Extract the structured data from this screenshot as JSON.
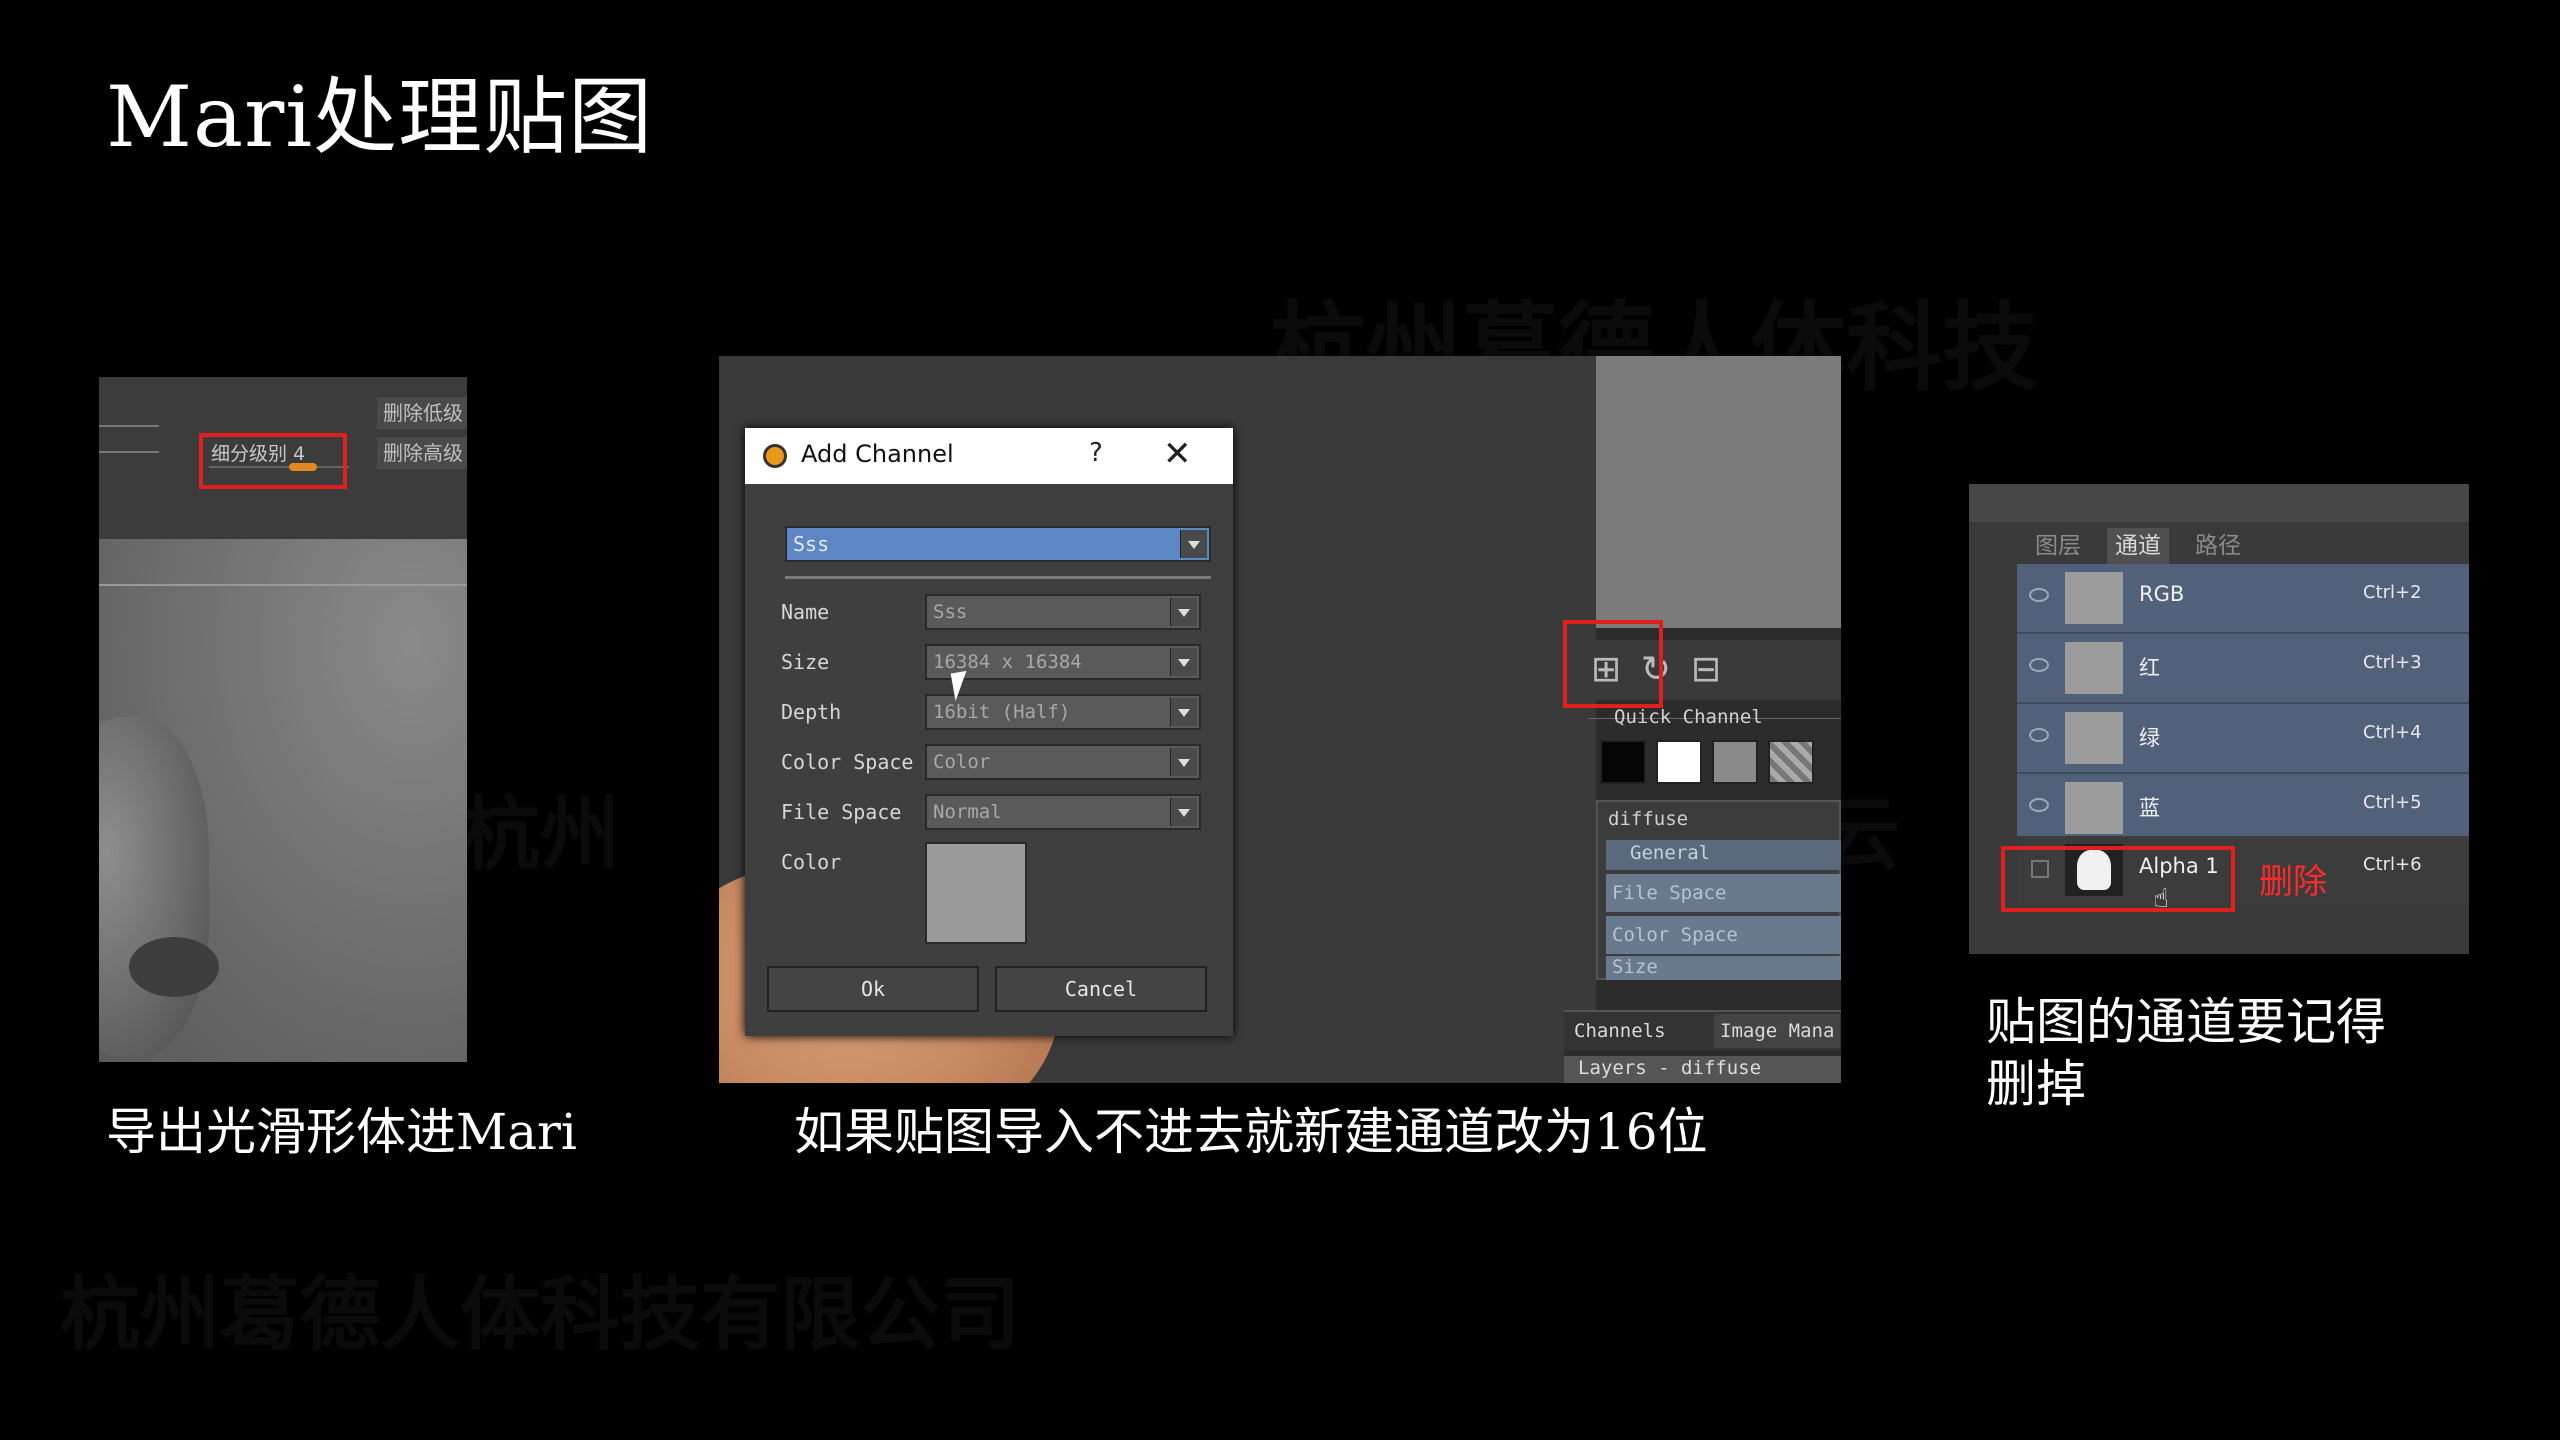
{
  "slide": {
    "title": "Mari处理贴图"
  },
  "watermarks": {
    "top": "杭州葛德人体科技",
    "bottom": "杭州葛德人体科技有限公司",
    "mid_left": "杭州",
    "mid_right": "云"
  },
  "panel_zbrush": {
    "subdivision_label": "细分级别 4",
    "buttons": [
      "删除低级",
      "删除高级"
    ],
    "caption": "导出光滑形体进Mari"
  },
  "panel_mari": {
    "dialog": {
      "title": "Add Channel",
      "help": "?",
      "close": "✕",
      "channel_preset": "Sss",
      "fields": [
        {
          "label": "Name",
          "value": "Sss"
        },
        {
          "label": "Size",
          "value": "16384 x 16384"
        },
        {
          "label": "Depth",
          "value": "16bit (Half)"
        },
        {
          "label": "Color Space",
          "value": "Color"
        },
        {
          "label": "File Space",
          "value": "Normal"
        },
        {
          "label": "Color",
          "value": ""
        }
      ],
      "ok": "Ok",
      "cancel": "Cancel"
    },
    "side": {
      "quick_channel": "Quick Channel",
      "diffuse": "diffuse",
      "general": "General",
      "rows": [
        "File Space",
        "Color Space",
        "Size"
      ],
      "tabs": [
        "Channels",
        "Image Mana"
      ],
      "layers_label": "Layers - diffuse",
      "tools": [
        "add-channel-icon",
        "refresh-icon",
        "remove-channel-icon"
      ]
    },
    "caption": "如果贴图导入不进去就新建通道改为16位"
  },
  "panel_photoshop": {
    "tabs": [
      "图层",
      "通道",
      "路径"
    ],
    "active_tab": "通道",
    "channels": [
      {
        "name": "RGB",
        "shortcut": "Ctrl+2"
      },
      {
        "name": "红",
        "shortcut": "Ctrl+3"
      },
      {
        "name": "绿",
        "shortcut": "Ctrl+4"
      },
      {
        "name": "蓝",
        "shortcut": "Ctrl+5"
      }
    ],
    "alpha": {
      "name": "Alpha 1",
      "shortcut": "Ctrl+6"
    },
    "annotation": "删除",
    "caption_line1": "贴图的通道要记得",
    "caption_line2": "删掉"
  },
  "colors": {
    "background": "#000000",
    "highlight_box": "#e02020",
    "mari_selection": "#5c87c4",
    "ps_selected_row": "#52617a"
  }
}
